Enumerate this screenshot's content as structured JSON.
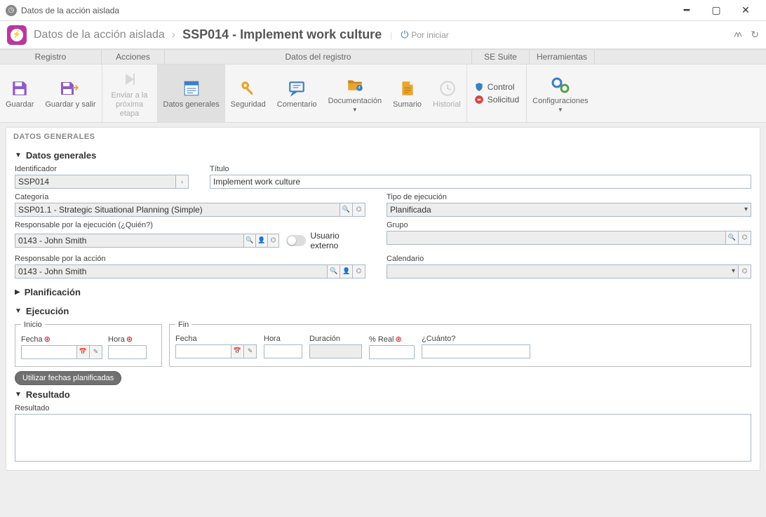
{
  "window": {
    "title": "Datos de la acción aislada"
  },
  "breadcrumb": {
    "root": "Datos de la acción aislada",
    "current": "SSP014 - Implement work culture",
    "status": "Por iniciar"
  },
  "ribbon": {
    "tabs": {
      "registro": "Registro",
      "acciones": "Acciones",
      "datos": "Datos del registro",
      "suite": "SE Suite",
      "herr": "Herramientas"
    }
  },
  "toolbar": {
    "guardar": "Guardar",
    "guardar_salir": "Guardar y salir",
    "enviar": "Enviar a la próxima etapa",
    "datos_gen": "Datos generales",
    "seguridad": "Seguridad",
    "comentario": "Comentario",
    "documentacion": "Documentación",
    "sumario": "Sumario",
    "historial": "Historial",
    "control": "Control",
    "solicitud": "Solicitud",
    "config": "Configuraciones"
  },
  "panel": {
    "header": "DATOS GENERALES"
  },
  "sections": {
    "datos_generales": "Datos generales",
    "planificacion": "Planificación",
    "ejecucion": "Ejecución",
    "resultado": "Resultado"
  },
  "labels": {
    "identificador": "Identificador",
    "titulo": "Título",
    "categoria": "Categoría",
    "tipo_ejec": "Tipo de ejecución",
    "responsable_ejec": "Responsable por la ejecución (¿Quién?)",
    "grupo": "Grupo",
    "usuario_externo": "Usuario externo",
    "responsable_accion": "Responsable por la acción",
    "calendario": "Calendario",
    "inicio": "Inicio",
    "fin": "Fin",
    "fecha": "Fecha",
    "hora": "Hora",
    "duracion": "Duración",
    "pct_real": "% Real",
    "cuanto": "¿Cuánto?",
    "resultado": "Resultado"
  },
  "values": {
    "identificador": "SSP014",
    "titulo": "Implement work culture",
    "categoria": "SSP01.1 - Strategic Situational Planning (Simple)",
    "tipo_ejec": "Planificada",
    "responsable_ejec": "0143 - John Smith",
    "responsable_accion": "0143 - John Smith",
    "grupo": "",
    "calendario": ""
  },
  "buttons": {
    "use_planned_dates": "Utilizar fechas planificadas"
  }
}
